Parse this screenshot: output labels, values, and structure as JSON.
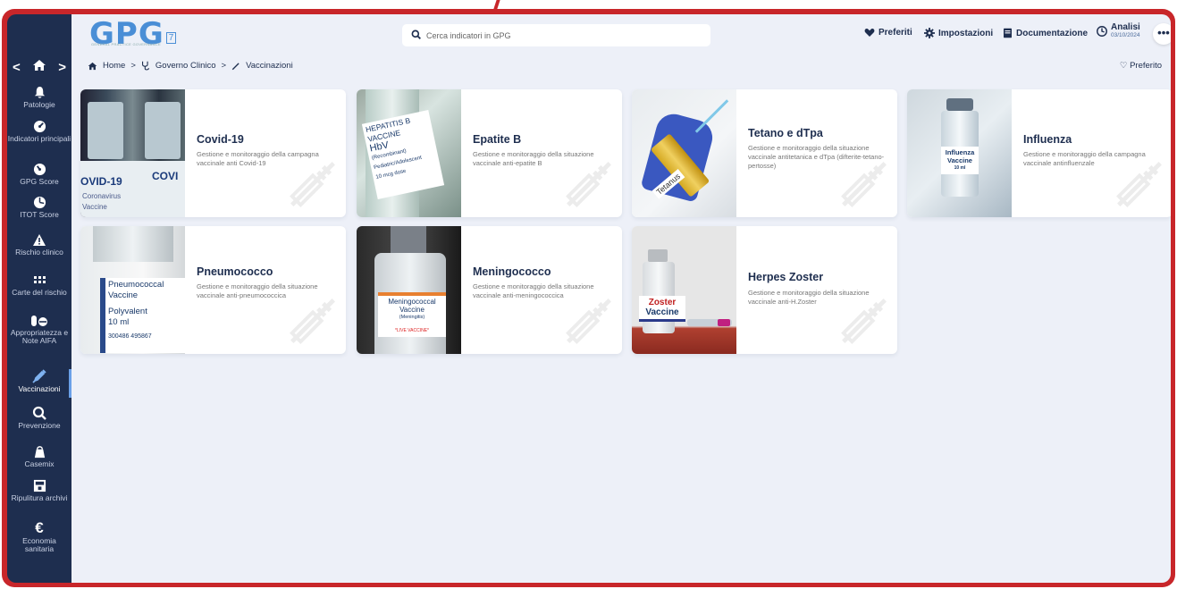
{
  "app": {
    "logo": "GPG",
    "logo_subtitle": "GENERAL PRACTICE GOVERNANCE",
    "logo_badge": "7",
    "search_placeholder": "Cerca indicatori in GPG",
    "preferiti": "Preferiti",
    "impostazioni": "Impostazioni",
    "documentazione": "Documentazione",
    "analisi_label": "Analisi",
    "analisi_date": "03/10/2024",
    "more": "•••"
  },
  "sidebar": {
    "nav_back": "<",
    "nav_forward": ">",
    "items": [
      {
        "label": "Patologie",
        "icon": "bell-icon"
      },
      {
        "label": "Indicatori principali",
        "icon": "gauge-icon"
      },
      {
        "label": "GPG Score",
        "icon": "score-dial-icon"
      },
      {
        "label": "ITOT Score",
        "icon": "pie-dial-icon"
      },
      {
        "label": "Rischio clinico",
        "icon": "warning-icon"
      },
      {
        "label": "Carte del rischio",
        "icon": "grid-icon"
      },
      {
        "label": "Appropriatezza e Note AIFA",
        "icon": "pills-icon"
      },
      {
        "label": "Vaccinazioni",
        "icon": "syringe-icon"
      },
      {
        "label": "Prevenzione",
        "icon": "search-icon"
      },
      {
        "label": "Casemix",
        "icon": "bag-icon"
      },
      {
        "label": "Ripulitura archivi",
        "icon": "archive-icon"
      },
      {
        "label": "Economia sanitaria",
        "icon": "euro-icon"
      }
    ]
  },
  "breadcrumb": {
    "home": "Home",
    "sep": ">",
    "level1": "Governo Clinico",
    "level2": "Vaccinazioni"
  },
  "favorite_label": "Preferito",
  "cards": [
    {
      "title": "Covid-19",
      "desc": "Gestione e monitoraggio della campagna vaccinale anti Covid-19",
      "image_text": [
        "OVID-19",
        "COVI",
        "Coronavirus",
        "Vaccine"
      ]
    },
    {
      "title": "Epatite B",
      "desc": "Gestione e monitoraggio della situazione vaccinale anti-epatite B",
      "image_text": [
        "HEPATITIS B",
        "VACCINE",
        "HbV",
        "(Recombinant)",
        "Pediatric/Adolescent",
        "10 mcg dose"
      ]
    },
    {
      "title": "Tetano e dTpa",
      "desc": "Gestione e monitoraggio della situazione vaccinale antitetanica e dTpa (difterite-tetano-pertosse)",
      "image_text": [
        "Tetanus"
      ]
    },
    {
      "title": "Influenza",
      "desc": "Gestione e monitoraggio della campagna vaccinale antinfluenzale",
      "image_text": [
        "Influenza",
        "Vaccine",
        "10 ml"
      ]
    },
    {
      "title": "Pneumococco",
      "desc": "Gestione e monitoraggio della situazione vaccinale anti-pneumococcica",
      "image_text": [
        "Pneumococcal",
        "Vaccine",
        "Polyvalent",
        "10 ml",
        "300486 495867"
      ]
    },
    {
      "title": "Meningococco",
      "desc": "Gestione e monitoraggio della situazione vaccinale anti-meningococcica",
      "image_text": [
        "Meningococcal",
        "Vaccine",
        "(Meningitis)",
        "*LIVE VACCINE*"
      ]
    },
    {
      "title": "Herpes Zoster",
      "desc": "Gestione e monitoraggio della situazione vaccinale anti-H.Zoster",
      "image_text": [
        "Zoster",
        "Vaccine"
      ]
    }
  ],
  "colors": {
    "frame": "#c8262a",
    "sidebar": "#1e2e4f",
    "background": "#edf0f8",
    "accent": "#4a8ed6"
  }
}
